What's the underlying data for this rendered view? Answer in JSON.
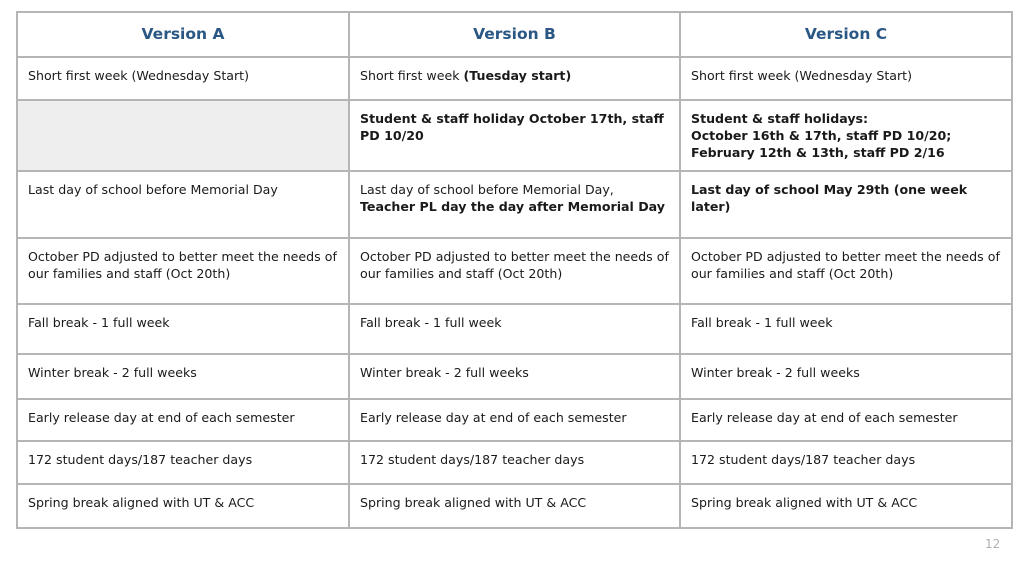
{
  "table": {
    "headers": [
      "Version A",
      "Version B",
      "Version C"
    ],
    "rows": [
      {
        "a": "Short first week (Wednesday Start)",
        "b_normal": "Short first week ",
        "b_bold": "(Tuesday start)",
        "c": "Short first week (Wednesday Start)"
      },
      {
        "a": "",
        "b_bold": "Student & staff holiday October 17th, staff PD 10/20",
        "c_line1": "Student & staff holidays:",
        "c_line2": "October 16th & 17th, staff PD 10/20;",
        "c_line3": "February 12th & 13th, staff PD 2/16"
      },
      {
        "a": "Last day of school before Memorial Day",
        "b_normal": "Last day of school before Memorial Day,",
        "b_bold": "Teacher PL day the day after Memorial Day",
        "c_bold": "Last day of school May 29th (one week later)"
      },
      {
        "a": "October PD adjusted to better meet the needs of our families and staff (Oct 20th)",
        "b": "October PD adjusted to better meet the needs of our families and staff (Oct 20th)",
        "c": "October PD adjusted to better meet the needs of our families and staff (Oct 20th)"
      },
      {
        "a": "Fall break - 1 full week",
        "b": "Fall break - 1 full week",
        "c": "Fall break - 1 full week"
      },
      {
        "a": "Winter break - 2 full weeks",
        "b": "Winter break - 2 full weeks",
        "c": "Winter break - 2 full weeks"
      },
      {
        "a": "Early release day at end of each semester",
        "b": "Early release day at end of each semester",
        "c": "Early release day at end of each semester"
      },
      {
        "a": "172 student days/187 teacher days",
        "b": "172 student days/187 teacher days",
        "c": "172 student days/187 teacher days"
      },
      {
        "a": "Spring break aligned with UT & ACC",
        "b": "Spring break aligned with UT & ACC",
        "c": "Spring break aligned with UT & ACC"
      }
    ]
  },
  "page_number": "12",
  "colors": {
    "header_text": "#2a5783",
    "border": "#b5b5b5",
    "empty_cell": "#eeeeee"
  }
}
